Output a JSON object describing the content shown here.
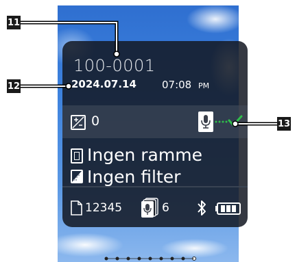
{
  "callouts": {
    "file_number": "11",
    "date": "12",
    "link_status": "13"
  },
  "info": {
    "file_number": "100-0001",
    "date": "2024.07.14",
    "time": "07:08",
    "ampm": "PM"
  },
  "exposure": {
    "icon": "exposure-compensation-icon",
    "value": "0"
  },
  "voice_memo_link": {
    "icon": "voice-memo-icon",
    "status_icon": "connected-check-icon"
  },
  "frame": {
    "icon": "frame-icon",
    "label": "Ingen ramme"
  },
  "filter": {
    "icon": "filter-icon",
    "label": "Ingen filter"
  },
  "footer": {
    "file_icon": "file-icon",
    "file_count": "12345",
    "memo_icon": "voice-memo-stack-icon",
    "memo_count": "6",
    "bluetooth_icon": "bluetooth-icon",
    "battery_icon": "battery-icon",
    "battery_level": 1.0
  },
  "page_indicator": {
    "total": 9
  },
  "colors": {
    "panel": "#14192380",
    "link_green": "#2fbf4a",
    "callout_bg": "#1a1a1a"
  }
}
